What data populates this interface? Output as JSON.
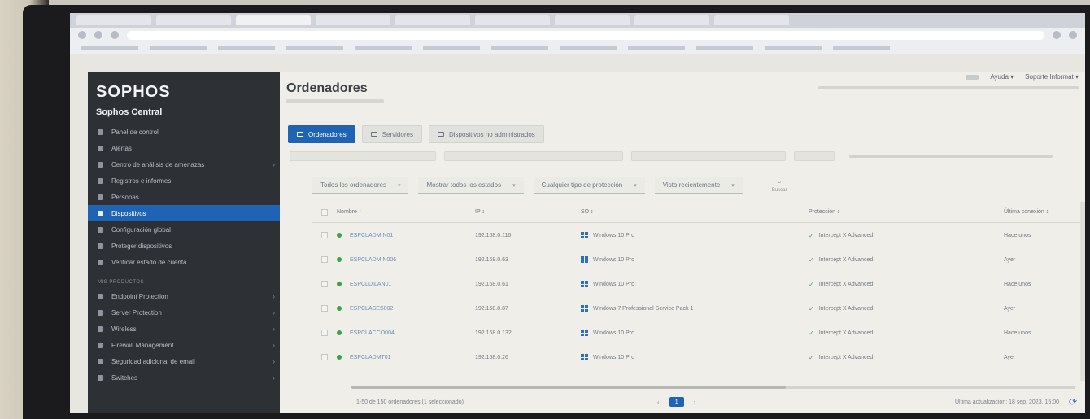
{
  "sidebar": {
    "logo": "SOPHOS",
    "product": "Sophos Central",
    "items": [
      {
        "label": "Panel de control"
      },
      {
        "label": "Alertas"
      },
      {
        "label": "Centro de análisis de amenazas",
        "arrow": "›"
      },
      {
        "label": "Registros e informes"
      },
      {
        "label": "Personas"
      },
      {
        "label": "Dispositivos",
        "active": true
      },
      {
        "label": "Configuración global"
      },
      {
        "label": "Proteger dispositivos"
      },
      {
        "label": "Verificar estado de cuenta"
      }
    ],
    "section_label": "MIS PRODUCTOS",
    "products": [
      {
        "label": "Endpoint Protection",
        "arrow": "›"
      },
      {
        "label": "Server Protection",
        "arrow": "›"
      },
      {
        "label": "Wireless",
        "arrow": "›"
      },
      {
        "label": "Firewall Management",
        "arrow": "›"
      },
      {
        "label": "Seguridad adicional de email",
        "arrow": "›"
      },
      {
        "label": "Switches",
        "arrow": "›"
      }
    ]
  },
  "header": {
    "title": "Ordenadores",
    "help": "Ayuda",
    "help_chevron": "▾",
    "user": "Soporte Informat",
    "user_chevron": "▾"
  },
  "tabs": [
    {
      "label": "Ordenadores",
      "active": true
    },
    {
      "label": "Servidores"
    },
    {
      "label": "Dispositivos no administrados"
    }
  ],
  "filters": [
    {
      "label": "Todos los ordenadores"
    },
    {
      "label": "Mostrar todos los estados"
    },
    {
      "label": "Cualquier tipo de protección"
    },
    {
      "label": "Visto recientemente"
    }
  ],
  "search": {
    "icon": "search-icon",
    "glyph": "⌕",
    "label": "Buscar"
  },
  "table": {
    "columns": {
      "name": "Nombre ↑",
      "ip": "IP ↕",
      "os": "SO ↕",
      "protection": "Protección ↕",
      "last_seen": "Última conexión ↕"
    },
    "rows": [
      {
        "name": "ESPCLADMIN01",
        "ip": "192.168.0.116",
        "os": "Windows 10 Pro",
        "protection": "Intercept X Advanced",
        "last": "Hace unos"
      },
      {
        "name": "ESPCLADMIN006",
        "ip": "192.168.0.63",
        "os": "Windows 10 Pro",
        "protection": "Intercept X Advanced",
        "last": "Ayer"
      },
      {
        "name": "ESPCLDILAN01",
        "ip": "192.168.0.61",
        "os": "Windows 10 Pro",
        "protection": "Intercept X Advanced",
        "last": "Hace unos"
      },
      {
        "name": "ESPCLASES002",
        "ip": "192.168.0.87",
        "os": "Windows 7 Professional Service Pack 1",
        "protection": "Intercept X Advanced",
        "last": "Ayer"
      },
      {
        "name": "ESPCLACCO004",
        "ip": "192.168.0.132",
        "os": "Windows 10 Pro",
        "protection": "Intercept X Advanced",
        "last": "Hace unos"
      },
      {
        "name": "ESPCLADMT01",
        "ip": "192.168.0.26",
        "os": "Windows 10 Pro",
        "protection": "Intercept X Advanced",
        "last": "Ayer"
      }
    ]
  },
  "footer": {
    "count": "1-50 de 150 ordenadores (1 seleccionado)",
    "page_prev": "‹",
    "page_current": "1",
    "page_next": "›",
    "updated": "Última actualización: 18 sep. 2023, 15:00",
    "refresh_icon": "⟳"
  },
  "colors": {
    "accent": "#1f63b4",
    "sidebar_bg": "#2d3136",
    "status_ok": "#3fa24a"
  }
}
